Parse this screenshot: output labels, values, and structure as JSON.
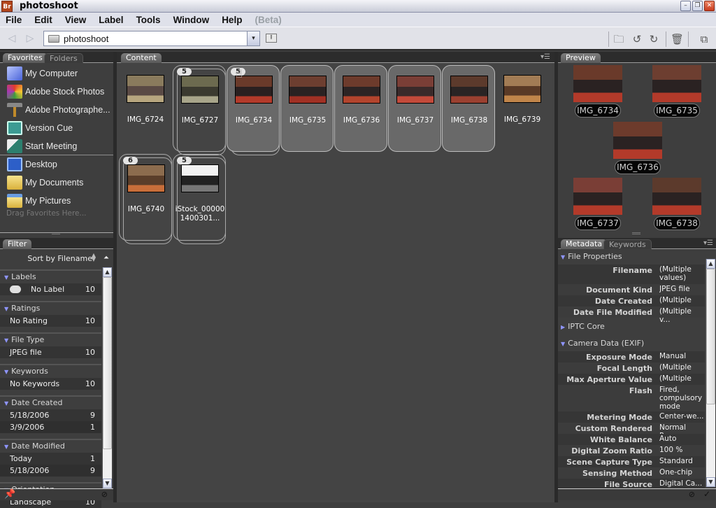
{
  "window": {
    "app_badge": "Br",
    "title": "photoshoot",
    "controls": {
      "minimize": "–",
      "restore": "❐",
      "close": "✕"
    }
  },
  "menubar": {
    "items": [
      "File",
      "Edit",
      "View",
      "Label",
      "Tools",
      "Window",
      "Help"
    ],
    "beta": "(Beta)"
  },
  "toolbar": {
    "back_icon": "◁",
    "forward_icon": "▷",
    "path": "photoshoot",
    "dropdown_icon": "▾",
    "up_icon": "⭱",
    "new_folder_icon": "🗀",
    "rotate_left_icon": "↺",
    "rotate_right_icon": "↻",
    "delete_icon": "🗑",
    "compact_mode_icon": "⧉"
  },
  "favorites_panel": {
    "tabs": [
      "Favorites",
      "Folders"
    ],
    "items": [
      {
        "label": "My Computer",
        "icon": "computer-icon"
      },
      {
        "label": "Adobe Stock Photos",
        "icon": "stock-photos-icon"
      },
      {
        "label": "Adobe Photographe...",
        "icon": "photographer-icon"
      },
      {
        "label": "Version Cue",
        "icon": "version-cue-icon"
      },
      {
        "label": "Start Meeting",
        "icon": "meeting-icon"
      },
      {
        "label": "Desktop",
        "icon": "desktop-icon"
      },
      {
        "label": "My Documents",
        "icon": "folder-icon"
      },
      {
        "label": "My Pictures",
        "icon": "pictures-folder-icon"
      }
    ],
    "drag_hint": "Drag Favorites Here..."
  },
  "filter_panel": {
    "tab": "Filter",
    "sort_label": "Sort by Filename",
    "sections": [
      {
        "title": "Labels",
        "rows": [
          {
            "label": "No Label",
            "count": "10"
          }
        ]
      },
      {
        "title": "Ratings",
        "rows": [
          {
            "label": "No Rating",
            "count": "10"
          }
        ]
      },
      {
        "title": "File Type",
        "rows": [
          {
            "label": "JPEG file",
            "count": "10"
          }
        ]
      },
      {
        "title": "Keywords",
        "rows": [
          {
            "label": "No Keywords",
            "count": "10"
          }
        ]
      },
      {
        "title": "Date Created",
        "rows": [
          {
            "label": "5/18/2006",
            "count": "9"
          },
          {
            "label": "3/9/2006",
            "count": "1"
          }
        ]
      },
      {
        "title": "Date Modified",
        "rows": [
          {
            "label": "Today",
            "count": "1"
          },
          {
            "label": "5/18/2006",
            "count": "9"
          }
        ]
      },
      {
        "title": "Orientation",
        "rows": [
          {
            "label": "Landscape",
            "count": "10"
          }
        ]
      }
    ]
  },
  "content_panel": {
    "tab": "Content",
    "items": [
      {
        "name": "IMG_6724",
        "stack": "",
        "selected": false
      },
      {
        "name": "IMG_6727",
        "stack": "5",
        "selected": false
      },
      {
        "name": "IMG_6734",
        "stack": "5",
        "selected": true
      },
      {
        "name": "IMG_6735",
        "stack": "",
        "selected": true
      },
      {
        "name": "IMG_6736",
        "stack": "",
        "selected": true
      },
      {
        "name": "IMG_6737",
        "stack": "",
        "selected": true
      },
      {
        "name": "IMG_6738",
        "stack": "",
        "selected": true
      },
      {
        "name": "IMG_6739",
        "stack": "",
        "selected": false
      },
      {
        "name": "IMG_6740",
        "stack": "6",
        "selected": false
      },
      {
        "name": "iStock_00000\n1400301...",
        "stack": "5",
        "selected": false
      }
    ]
  },
  "preview_panel": {
    "tab": "Preview",
    "items": [
      "IMG_6734",
      "IMG_6735",
      "IMG_6736",
      "IMG_6737",
      "IMG_6738"
    ]
  },
  "metadata_panel": {
    "tabs": [
      "Metadata",
      "Keywords"
    ],
    "sections": {
      "file_properties": {
        "title": "File Properties",
        "rows": [
          {
            "key": "Filename",
            "value": "(Multiple values)"
          },
          {
            "key": "Document Kind",
            "value": "JPEG file"
          },
          {
            "key": "Date Created",
            "value": "(Multiple v..."
          },
          {
            "key": "Date File Modified",
            "value": "(Multiple v..."
          }
        ]
      },
      "iptc": {
        "title": "IPTC Core"
      },
      "exif": {
        "title": "Camera Data (EXIF)",
        "rows": [
          {
            "key": "Exposure Mode",
            "value": "Manual"
          },
          {
            "key": "Focal Length",
            "value": "(Multiple v..."
          },
          {
            "key": "Max Aperture Value",
            "value": "(Multiple v..."
          },
          {
            "key": "Flash",
            "value": "Fired, compulsory mode"
          },
          {
            "key": "Metering Mode",
            "value": "Center-we..."
          },
          {
            "key": "Custom Rendered",
            "value": "Normal Pro..."
          },
          {
            "key": "White Balance",
            "value": "Auto"
          },
          {
            "key": "Digital Zoom Ratio",
            "value": "100 %"
          },
          {
            "key": "Scene Capture Type",
            "value": "Standard"
          },
          {
            "key": "Sensing Method",
            "value": "One-chip s..."
          },
          {
            "key": "File Source",
            "value": "Digital Ca..."
          }
        ]
      }
    }
  }
}
